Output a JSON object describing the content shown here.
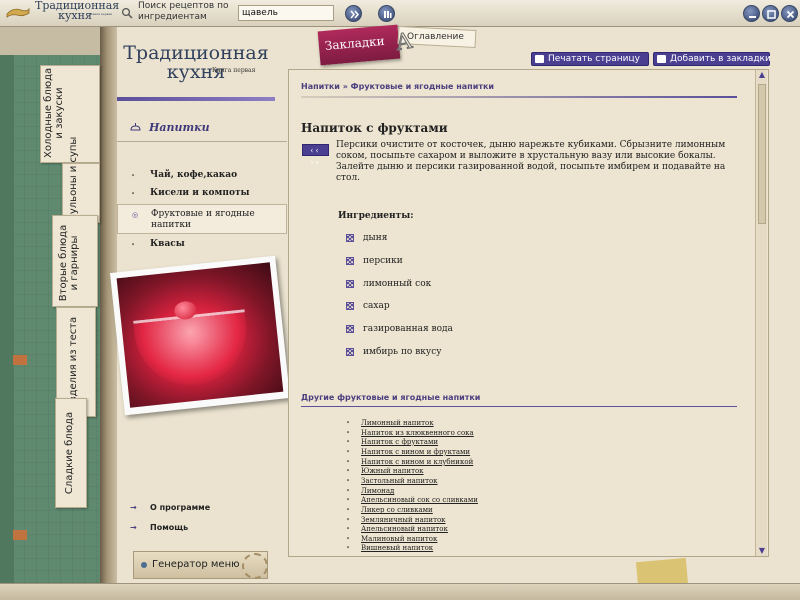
{
  "app": {
    "title_main": "Традиционная кухня",
    "title_sub": "Книга первая",
    "logo_icon": "book-logo-icon"
  },
  "toolbar": {
    "search_label": "Поиск рецептов по ингредиентам",
    "search_value": "щавель",
    "search_icon": "search-icon",
    "go_icon": "double-chevron-right-icon",
    "advanced_icon": "advanced-search-icon",
    "window_icons": [
      "minimize-icon",
      "maximize-icon",
      "close-icon"
    ]
  },
  "book": {
    "title_line1": "Традиционная",
    "title_line2": "кухня",
    "subtitle": "Книга первая"
  },
  "side_tabs": [
    {
      "label_line1": "Холодные блюда",
      "label_line2": "и закуски"
    },
    {
      "label_line1": "Бульоны и супы",
      "label_line2": ""
    },
    {
      "label_line1": "Вторые блюда",
      "label_line2": "и гарниры"
    },
    {
      "label_line1": "Изделия из теста",
      "label_line2": ""
    },
    {
      "label_line1": "Сладкие блюда",
      "label_line2": ""
    }
  ],
  "ribbons": {
    "bookmarks": "Закладки",
    "contents": "Оглавление",
    "contents_letter": "A"
  },
  "actions": {
    "print": "Печатать страницу",
    "add_bookmark": "Добавить в закладки"
  },
  "section": {
    "title": "Напитки",
    "items": [
      {
        "label": "Чай, кофе,какао",
        "bold": true,
        "active": false
      },
      {
        "label": "Кисели и компоты",
        "bold": true,
        "active": false
      },
      {
        "label": "Фруктовые и ягодные напитки",
        "bold": false,
        "active": true
      },
      {
        "label": "Квасы",
        "bold": true,
        "active": false
      }
    ]
  },
  "footer_links": {
    "about": "О программе",
    "help": "Помощь",
    "menu_generator": "Генератор меню"
  },
  "breadcrumb": {
    "root": "Напитки",
    "separator": "»",
    "current": "Фруктовые и ягодные напитки"
  },
  "recipe": {
    "title": "Напиток с фруктами",
    "nav_arrows": "‹‹ ››",
    "text": "Персики очистите от косточек, дыню нарежьте кубиками. Сбрызните лимонным соком, посыпьте сахаром и выложите в хрустальную вазу или высокие бокалы. Залейте дыню и персики газированной водой, посыпьте имбирем и подавайте на стол.",
    "ingredients_title": "Ингредиенты:",
    "ingredients": [
      "дыня",
      "персики",
      "лимонный сок",
      "сахар",
      "газированная вода",
      "имбирь по вкусу"
    ]
  },
  "other": {
    "title": "Другие фруктовые и ягодные напитки",
    "items": [
      "Лимонный напиток",
      "Напиток из клюквенного сока",
      "Напиток с фруктами",
      "Напиток с вином и фруктами",
      "Напиток с вином и клубникой",
      "Южный напиток",
      "Застольный напиток",
      "Лимонад",
      "Апельсиновый сок со сливками",
      "Ликер со сливками",
      "Земляничный напиток",
      "Апельсиновый напиток",
      "Малиновый напиток",
      "Вишневый напиток"
    ]
  },
  "scrollbar": {
    "up_icon": "▲",
    "down_icon": "▼"
  },
  "colors": {
    "accent": "#4b3f92",
    "ribbon": "#b02a5c",
    "panel_green": "#5f8a70"
  }
}
